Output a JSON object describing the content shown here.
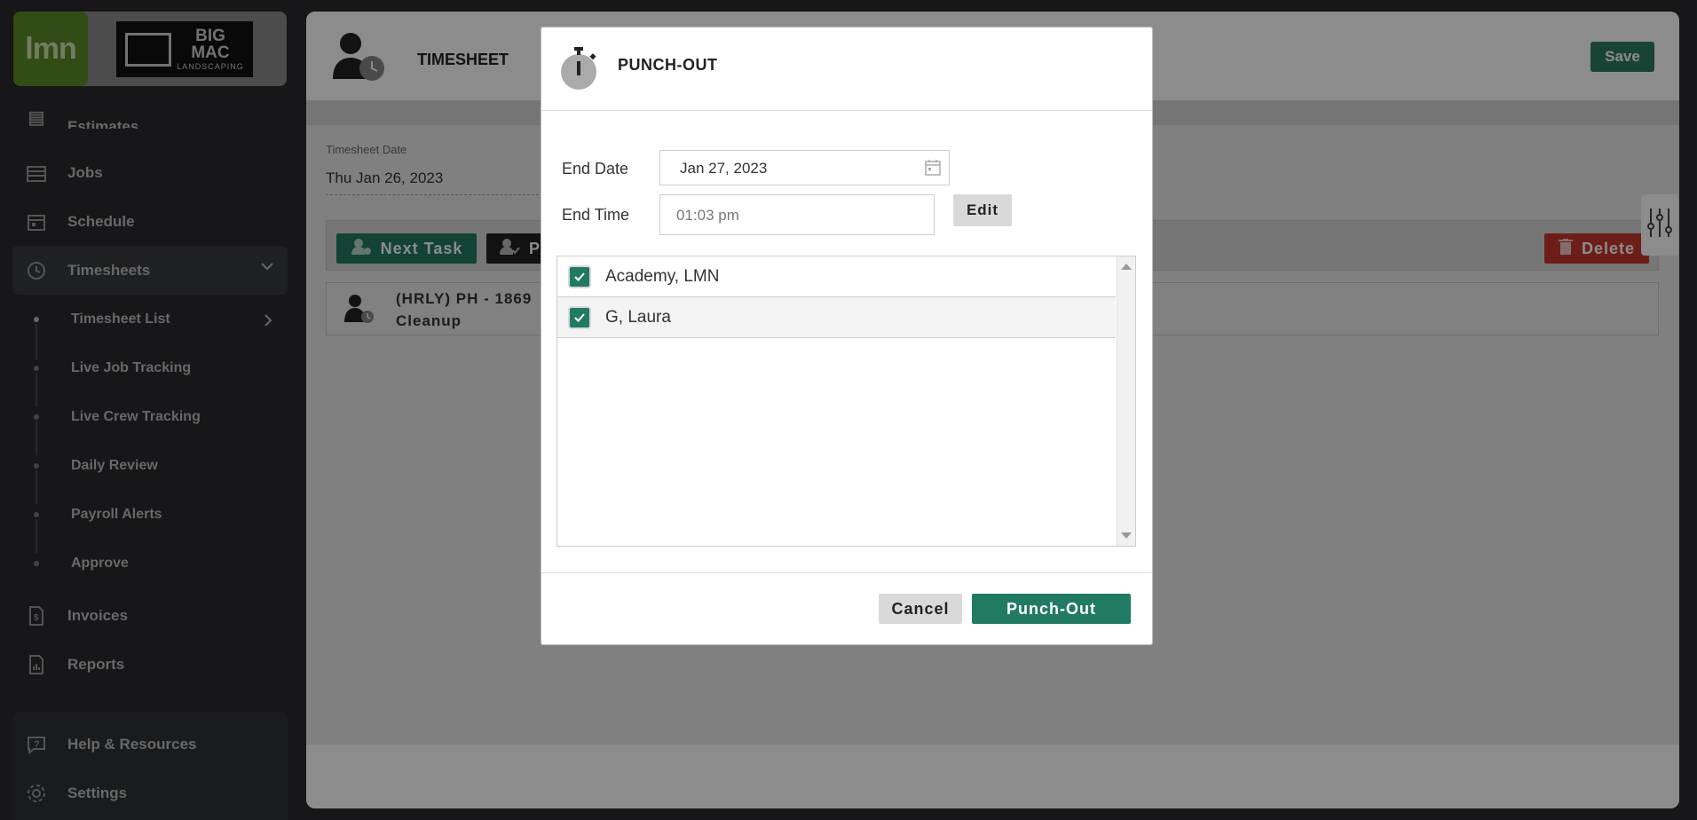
{
  "brand": {
    "lmn_logo_text": "lmn",
    "company_big": "BIG",
    "company_mac": "MAC",
    "company_sub": "LANDSCAPING"
  },
  "sidebar": {
    "items": [
      {
        "label": "Estimates",
        "icon": "estimates-icon"
      },
      {
        "label": "Jobs",
        "icon": "jobs-icon"
      },
      {
        "label": "Schedule",
        "icon": "calendar-icon"
      },
      {
        "label": "Timesheets",
        "icon": "clock-icon"
      }
    ],
    "sub_items": [
      {
        "label": "Timesheet List"
      },
      {
        "label": "Live Job Tracking"
      },
      {
        "label": "Live Crew Tracking"
      },
      {
        "label": "Daily Review"
      },
      {
        "label": "Payroll Alerts"
      },
      {
        "label": "Approve"
      }
    ],
    "lower_items": [
      {
        "label": "Invoices",
        "icon": "invoice-icon"
      },
      {
        "label": "Reports",
        "icon": "reports-icon"
      }
    ],
    "bottom_items": [
      {
        "label": "Help & Resources",
        "icon": "help-icon"
      },
      {
        "label": "Settings",
        "icon": "gear-icon"
      }
    ]
  },
  "main": {
    "title": "TIMESHEET",
    "save_label": "Save",
    "timesheet_date_label": "Timesheet Date",
    "timesheet_date_value": "Thu Jan 26, 2023",
    "next_task_label": "Next Task",
    "p_button_label": "P",
    "delete_label": "Delete",
    "task_line1": "(HRLY) PH - 1869",
    "task_line2": "Cleanup"
  },
  "modal": {
    "title": "PUNCH-OUT",
    "end_date_label": "End Date",
    "end_date_value": "Jan 27, 2023",
    "end_time_label": "End Time",
    "end_time_placeholder": "01:03 pm",
    "edit_label": "Edit",
    "employees": [
      {
        "name": "Academy, LMN",
        "checked": true
      },
      {
        "name": "G, Laura",
        "checked": true
      }
    ],
    "cancel_label": "Cancel",
    "punch_out_label": "Punch-Out"
  },
  "colors": {
    "accent_green": "#217a62",
    "delete_red": "#c7372f",
    "sidebar_bg": "#2a2b2e",
    "lmn_green": "#5a8a26"
  }
}
